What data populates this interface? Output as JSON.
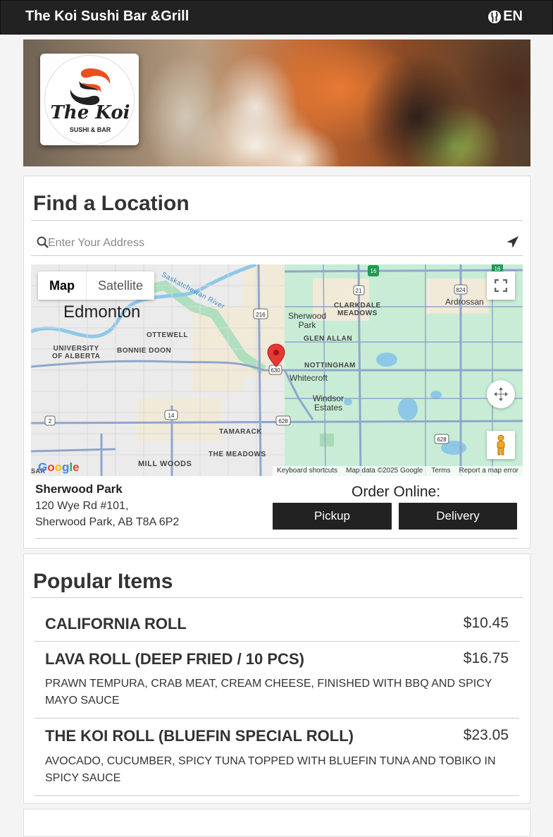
{
  "header": {
    "brand": "The Koi Sushi Bar &Grill",
    "language": "EN"
  },
  "logo": {
    "title": "The Koi",
    "subtitle": "SUSHI & BAR"
  },
  "location_panel": {
    "title": "Find a Location",
    "search_placeholder": "Enter Your Address",
    "map": {
      "type_buttons": [
        "Map",
        "Satellite"
      ],
      "labels": {
        "city": "Edmonton",
        "sherwood_park": "Sherwood\nPark",
        "clarkdale": "CLARKDALE\nMEADOWS",
        "ardrossan": "Ardrossan",
        "ottewell": "OTTEWELL",
        "bonnie_doon": "BONNIE DOON",
        "university": "UNIVERSITY\nOF ALBERTA",
        "glen_allan": "GLEN ALLAN",
        "nottingham": "NOTTINGHAM",
        "whitecroft": "Whitecroft",
        "windsor": "Windsor\nEstates",
        "tamarack": "TAMARACK",
        "meadows": "THE MEADOWS",
        "mill_woods": "MILL WOODS",
        "river": "Saskatchewan River",
        "sar": "SAR"
      },
      "route_shields": [
        "16",
        "16",
        "21",
        "824",
        "216",
        "630",
        "14",
        "628",
        "2",
        "628"
      ],
      "footer": [
        "Keyboard shortcuts",
        "Map data ©2025 Google",
        "Terms",
        "Report a map error"
      ],
      "google": "Google"
    },
    "location": {
      "name": "Sherwood Park",
      "address_line1": "120 Wye Rd #101,",
      "address_line2": "Sherwood Park, AB T8A 6P2"
    },
    "order_label": "Order Online:",
    "pickup_label": "Pickup",
    "delivery_label": "Delivery"
  },
  "popular_panel": {
    "title": "Popular Items",
    "items": [
      {
        "name": "CALIFORNIA ROLL",
        "price": "$10.45",
        "description": ""
      },
      {
        "name": "LAVA ROLL (DEEP FRIED / 10 PCS)",
        "price": "$16.75",
        "description": "PRAWN TEMPURA, CRAB MEAT, CREAM CHEESE, FINISHED WITH BBQ AND SPICY MAYO SAUCE"
      },
      {
        "name": "THE KOI ROLL (BLUEFIN SPECIAL ROLL)",
        "price": "$23.05",
        "description": "AVOCADO, CUCUMBER, SPICY TUNA TOPPED WITH BLUEFIN TUNA AND TOBIKO IN SPICY SAUCE"
      }
    ]
  },
  "colors": {
    "header_bg": "#222222",
    "button_bg": "#222222",
    "map_green": "#c8ecd6",
    "map_road": "#8fa6cc",
    "pin_red": "#e53935"
  }
}
